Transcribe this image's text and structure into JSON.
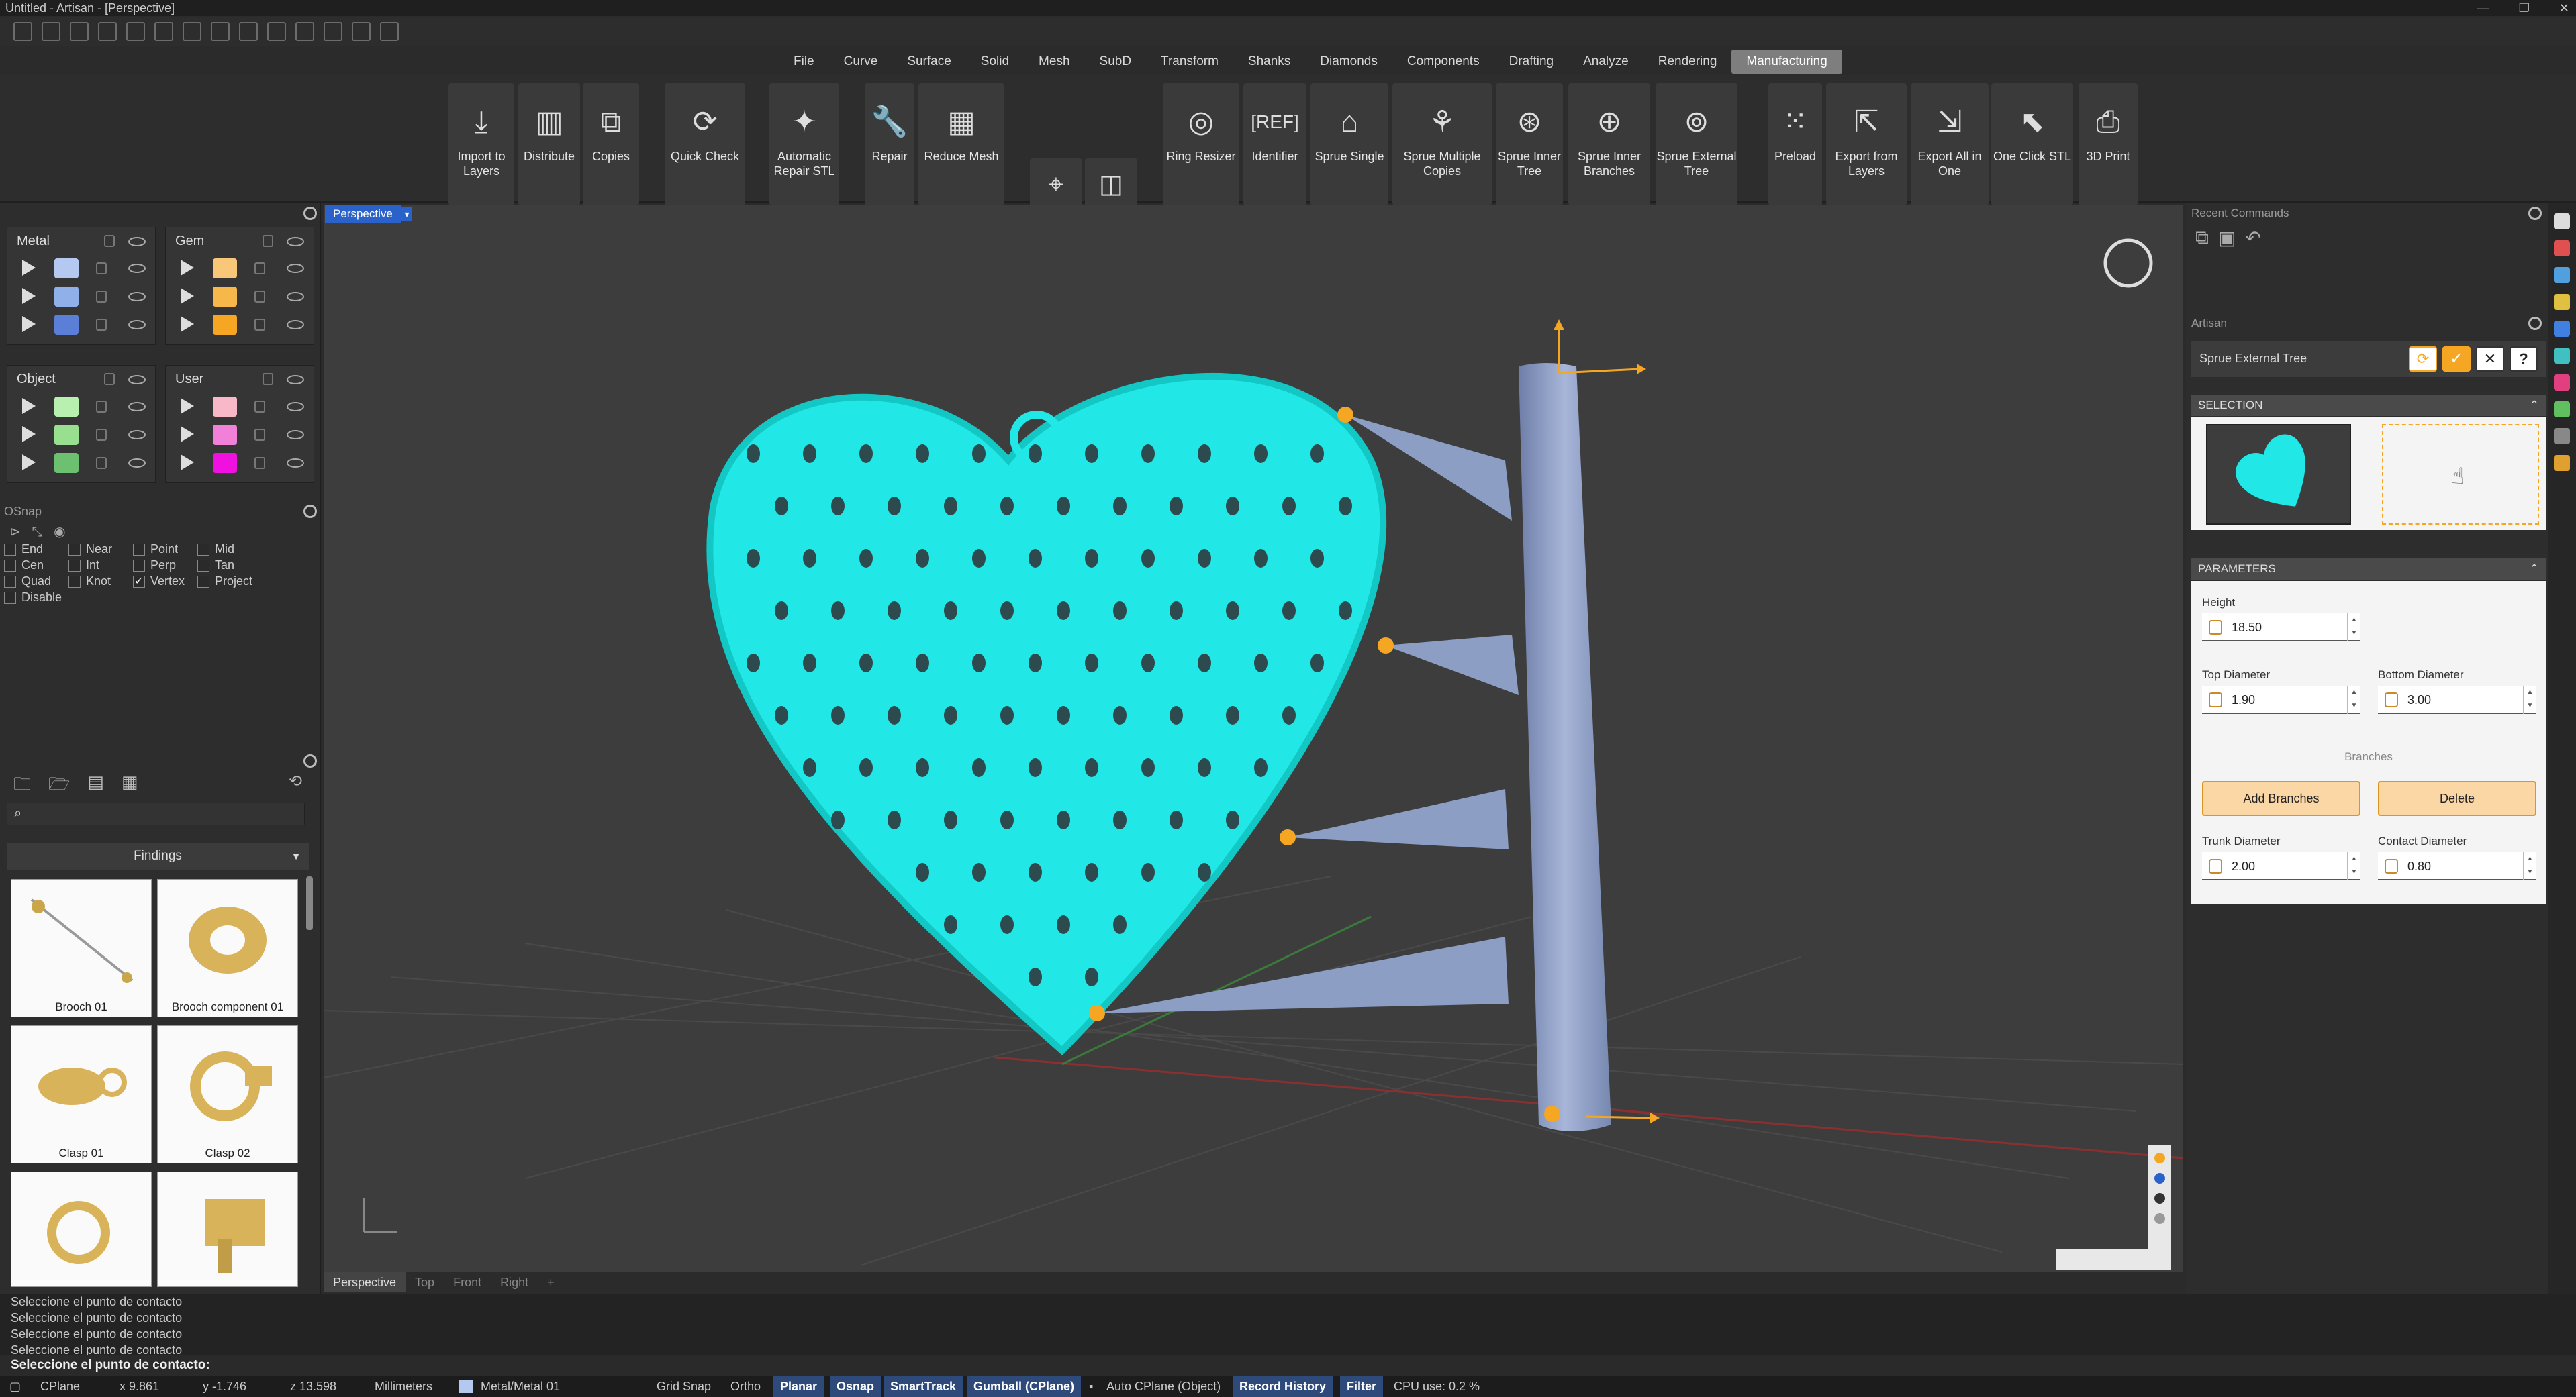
{
  "window": {
    "title": "Untitled - Artisan - [Perspective]"
  },
  "menu": [
    "File",
    "Curve",
    "Surface",
    "Solid",
    "Mesh",
    "SubD",
    "Transform",
    "Shanks",
    "Diamonds",
    "Components",
    "Drafting",
    "Analyze",
    "Rendering",
    "Manufacturing"
  ],
  "ribbon": {
    "import_to_layers": "Import to Layers",
    "distribute": "Distribute",
    "copies": "Copies",
    "quick_check": "Quick Check",
    "automatic_repair_stl": "Automatic Repair STL",
    "repair": "Repair",
    "reduce_mesh": "Reduce Mesh",
    "ring_resizer": "Ring Resizer",
    "identifier": "Identifier",
    "sprue_single": "Sprue Single",
    "sprue_multiple_copies": "Sprue Multiple Copies",
    "sprue_inner_tree": "Sprue Inner Tree",
    "sprue_inner_branches": "Sprue Inner Branches",
    "sprue_external_tree": "Sprue External Tree",
    "preload": "Preload",
    "export_from_layers": "Export from Layers",
    "export_all_in_one": "Export All in One",
    "one_click_stl": "One Click STL",
    "print_3d": "3D Print"
  },
  "layers": {
    "metal": {
      "title": "Metal",
      "colors": [
        "#b4c8f0",
        "#8fb0e8",
        "#5b7fd6"
      ]
    },
    "gem": {
      "title": "Gem",
      "colors": [
        "#f8c878",
        "#f6b84a",
        "#f5a623"
      ]
    },
    "object": {
      "title": "Object",
      "colors": [
        "#b8f0b0",
        "#98e090",
        "#6cc070"
      ]
    },
    "user": {
      "title": "User",
      "colors": [
        "#f8b8c8",
        "#f080d8",
        "#f010e0"
      ]
    }
  },
  "osnap": {
    "title": "OSnap",
    "items": [
      {
        "label": "End",
        "checked": false
      },
      {
        "label": "Near",
        "checked": false
      },
      {
        "label": "Point",
        "checked": false
      },
      {
        "label": "Mid",
        "checked": false
      },
      {
        "label": "Cen",
        "checked": false
      },
      {
        "label": "Int",
        "checked": false
      },
      {
        "label": "Perp",
        "checked": false
      },
      {
        "label": "Tan",
        "checked": false
      },
      {
        "label": "Quad",
        "checked": false
      },
      {
        "label": "Knot",
        "checked": false
      },
      {
        "label": "Vertex",
        "checked": true
      },
      {
        "label": "Project",
        "checked": false
      },
      {
        "label": "Disable",
        "checked": false
      }
    ]
  },
  "library": {
    "category": "Findings",
    "items": [
      "Brooch 01",
      "Brooch component 01",
      "Clasp 01",
      "Clasp 02"
    ]
  },
  "viewport": {
    "active_label": "Perspective",
    "tabs": [
      "Perspective",
      "Top",
      "Front",
      "Right"
    ],
    "add_tab": "+"
  },
  "right_panel": {
    "recent_commands": "Recent Commands",
    "artisan": "Artisan",
    "command_name": "Sprue External Tree",
    "selection_header": "SELECTION",
    "parameters_header": "PARAMETERS",
    "height_label": "Height",
    "height_value": "18.50",
    "top_diameter_label": "Top Diameter",
    "top_diameter_value": "1.90",
    "bottom_diameter_label": "Bottom Diameter",
    "bottom_diameter_value": "3.00",
    "branches_label": "Branches",
    "add_branches": "Add Branches",
    "delete": "Delete",
    "trunk_diameter_label": "Trunk Diameter",
    "trunk_diameter_value": "2.00",
    "contact_diameter_label": "Contact Diameter",
    "contact_diameter_value": "0.80",
    "help": "?"
  },
  "command_history": [
    "Seleccione el punto de contacto",
    "Seleccione el punto de contacto",
    "Seleccione el punto de contacto",
    "Seleccione el punto de contacto"
  ],
  "command_prompt": "Seleccione el punto de contacto:",
  "status": {
    "cplane": "CPlane",
    "x": "x 9.861",
    "y": "y -1.746",
    "z": "z 13.598",
    "units": "Millimeters",
    "layer": "Metal/Metal 01",
    "grid_snap": "Grid Snap",
    "ortho": "Ortho",
    "planar": "Planar",
    "osnap": "Osnap",
    "smarttrack": "SmartTrack",
    "gumball": "Gumball (CPlane)",
    "auto_cplane": "Auto CPlane (Object)",
    "record_history": "Record History",
    "filter": "Filter",
    "cpu": "CPU use: 0.2 %"
  },
  "colors": {
    "accent": "#f5a623",
    "mesh": "#21e8e6",
    "sprue": "#8c9ec4"
  }
}
